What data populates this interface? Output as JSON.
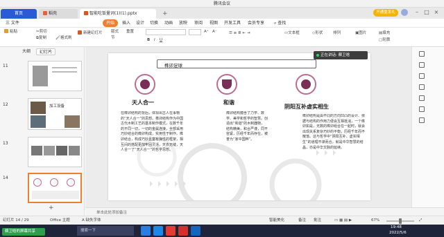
{
  "meeting": {
    "title": "腾讯会议"
  },
  "tabs": {
    "home": "首页",
    "shell": "稻壳",
    "file": "智能吃饭量词(1)(1).pptx"
  },
  "account": {
    "trial": "开通重发礼"
  },
  "menu": {
    "items": [
      "三 文件",
      "开始",
      "插入",
      "设计",
      "切换",
      "动画",
      "放映",
      "审阅",
      "视图",
      "开发工具",
      "会员专享"
    ],
    "search": "查找"
  },
  "toolbar": {
    "cut": "剪切",
    "copy": "复制",
    "format_painter": "格式刷",
    "paste": "粘贴",
    "new_slide": "新建幻灯片",
    "layout": "版式",
    "section": "节",
    "reset": "重置",
    "font_size_up": "A⁺",
    "font_size_down": "A⁻",
    "bold": "B",
    "italic": "I",
    "underline": "U",
    "textbox": "文本框",
    "shapes": "形状",
    "arrange": "排列",
    "picture": "图片",
    "fill": "填充",
    "outline": "轮廓"
  },
  "left_pane": {
    "tab_outline": "大纲",
    "tab_slides": "幻灯片",
    "slides": [
      {
        "num": "11",
        "caption": ""
      },
      {
        "num": "12",
        "caption": "加工设备"
      },
      {
        "num": "13",
        "caption": ""
      },
      {
        "num": "14",
        "caption": ""
      }
    ]
  },
  "slide": {
    "title": "榫卯足球",
    "columns": [
      {
        "title": "天人合一",
        "body": "在榫卯结构的背后，体现出古人在事物的“天人合一”的思想。榫卯结构作为中国古代木制工艺的基本制作模式，在数千年的不同一切，一切的金属连接，全部采用巧妙结合的榫卯构成，实用性于制作。榫卯结合，构成巧妙且富有弹性的框架，相互间的搭配更加牢固灵活，天衣无缝，天人合一了“天人合一”的哲学思想。"
      },
      {
        "title": "和谐",
        "body": "榫卯结构蕴含了力学、数学、美学和哲学的智慧。创造出“和谐”的木制器物，结构精美，和合严谨，同不容紧，历经千年而存在，被誉为“家中国粹”。"
      },
      {
        "title": "阴阳互补虚实相生",
        "body": "榫卯结构是由不同的方向凹凸的设计、依据与结构的作用力便会互相抵消，一个榫卯如是，无数的榫卯组合在一起时，就会出现关系复杂巧妙的平衡，历经千年而不散落。这与哲学中“阴阳互补、虚实相生”的道理不谋而合，就是中华智慧的结晶，亦是中华文脉的延续。"
      }
    ]
  },
  "speaker": {
    "label": "正在讲话: 蘇卫晗"
  },
  "notes": {
    "hint": "单击此处添加备注"
  },
  "status": {
    "slide_counter": "幻灯片 14 / 29",
    "theme": "Office 主题",
    "font_missing": "缺失字体",
    "smart_beautify": "智能美化",
    "notes": "备注",
    "comments": "批注",
    "zoom": "67%"
  },
  "taskbar": {
    "sharing": "蘇卫晗的屏幕共享",
    "search_placeholder": "搜索一下",
    "time": "19:48",
    "date": "2022/5/6"
  },
  "colors": {
    "accent": "#f27e2c",
    "brand": "#2a5bd7",
    "slide_accent": "#7a2e55",
    "taskbar": "#20243a"
  }
}
